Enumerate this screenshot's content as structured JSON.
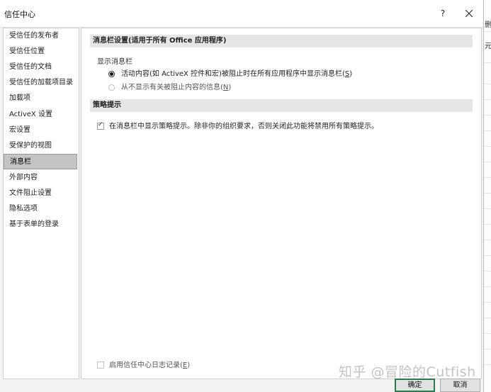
{
  "window": {
    "title": "信任中心",
    "help_glyph": "?"
  },
  "sidebar": {
    "items": [
      {
        "label": "受信任的发布者"
      },
      {
        "label": "受信任位置"
      },
      {
        "label": "受信任的文档"
      },
      {
        "label": "受信任的加载项目录"
      },
      {
        "label": "加载项"
      },
      {
        "label": "ActiveX 设置"
      },
      {
        "label": "宏设置"
      },
      {
        "label": "受保护的视图"
      },
      {
        "label": "消息栏"
      },
      {
        "label": "外部内容"
      },
      {
        "label": "文件阻止设置"
      },
      {
        "label": "隐私选项"
      },
      {
        "label": "基于表单的登录"
      }
    ],
    "active_index": 8
  },
  "main": {
    "section1_title": "消息栏设置(适用于所有 Office 应用程序)",
    "show_bar_label": "显示消息栏",
    "radio1": {
      "text": "活动内容(如 ActiveX 控件和宏)被阻止时在所有应用程序中显示消息栏(",
      "key": "S",
      "close": ")",
      "selected": true
    },
    "radio2": {
      "text": "从不显示有关被阻止内容的信息(",
      "key": "N",
      "close": ")",
      "selected": false
    },
    "section2_title": "策略提示",
    "policy_check": {
      "text": "在消息栏中显示策略提示。除非你的组织要求，否则关闭此功能将禁用所有策略提示。",
      "checked": true
    },
    "log_check": {
      "text": "启用信任中心日志记录(",
      "key": "E",
      "close": ")",
      "checked": false
    }
  },
  "buttons": {
    "ok": "确定",
    "cancel": "取消"
  },
  "background": {
    "text1": "删",
    "text2": "元"
  },
  "watermark": "知乎 @冒险的Cutfish"
}
